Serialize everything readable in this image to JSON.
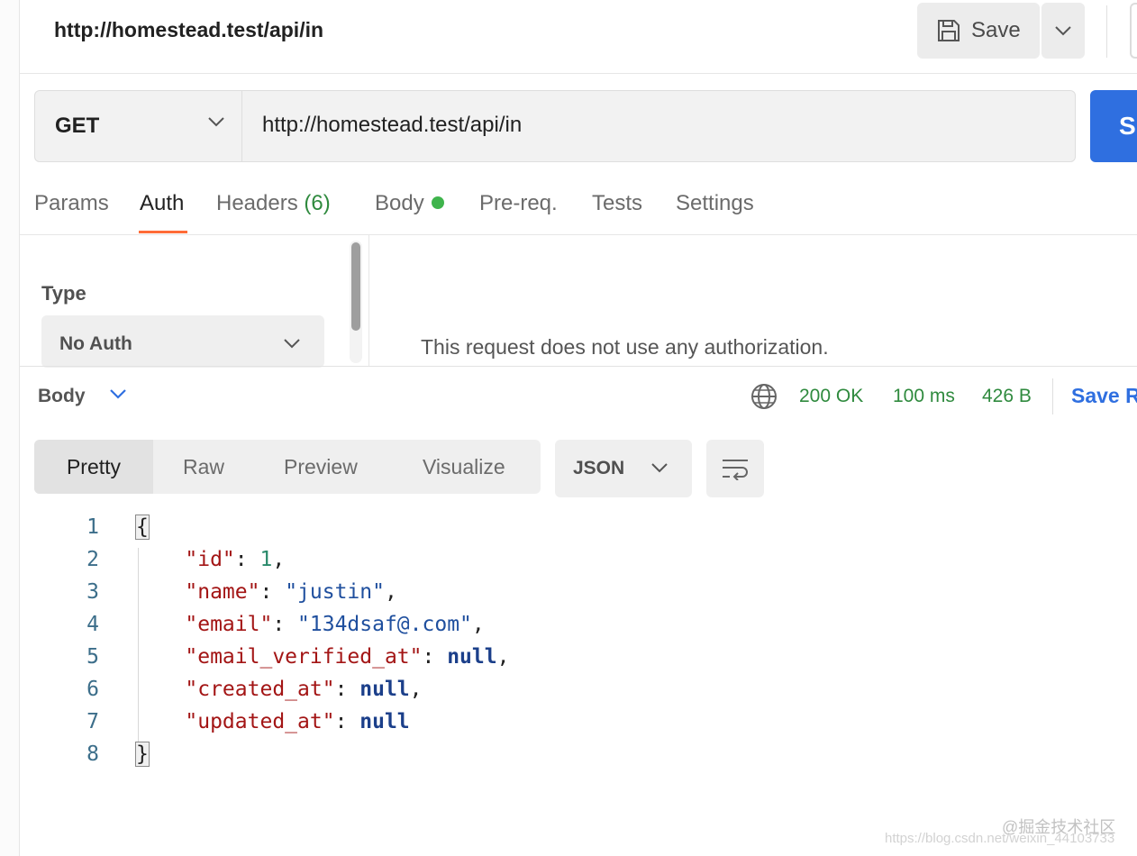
{
  "header": {
    "title": "http://homestead.test/api/in",
    "save_label": "Save"
  },
  "request": {
    "method": "GET",
    "url": "http://homestead.test/api/in",
    "send_label": "S"
  },
  "tabs": {
    "params": "Params",
    "auth": "Auth",
    "headers": "Headers",
    "headers_count": "(6)",
    "body": "Body",
    "prereq": "Pre-req.",
    "tests": "Tests",
    "settings": "Settings"
  },
  "auth": {
    "type_label": "Type",
    "type_value": "No Auth",
    "message": "This request does not use any authorization."
  },
  "response": {
    "section_label": "Body",
    "status": "200 OK",
    "time": "100 ms",
    "size": "426 B",
    "save_label": "Save R",
    "view_modes": [
      "Pretty",
      "Raw",
      "Preview",
      "Visualize"
    ],
    "format": "JSON"
  },
  "code": {
    "line_numbers": [
      "1",
      "2",
      "3",
      "4",
      "5",
      "6",
      "7",
      "8"
    ],
    "open_brace": "{",
    "close_brace": "}",
    "fields": [
      {
        "key": "\"id\"",
        "value": "1",
        "kind": "number",
        "suffix": ","
      },
      {
        "key": "\"name\"",
        "value": "\"justin\"",
        "kind": "string",
        "suffix": ","
      },
      {
        "key": "\"email\"",
        "value": "\"134dsaf@.com\"",
        "kind": "string",
        "suffix": ","
      },
      {
        "key": "\"email_verified_at\"",
        "value": "null",
        "kind": "null",
        "suffix": ","
      },
      {
        "key": "\"created_at\"",
        "value": "null",
        "kind": "null",
        "suffix": ","
      },
      {
        "key": "\"updated_at\"",
        "value": "null",
        "kind": "null",
        "suffix": ""
      }
    ]
  },
  "watermark": {
    "line1": "@掘金技术社区",
    "line2": "https://blog.csdn.net/weixin_44103733"
  },
  "colors": {
    "accent_orange": "#ff6c37",
    "send_blue": "#2f6fe0",
    "status_green": "#2f8a3e"
  }
}
